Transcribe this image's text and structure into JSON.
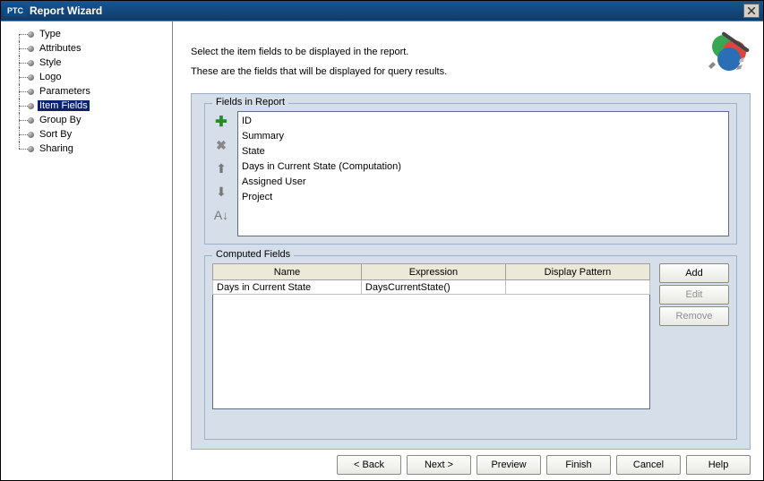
{
  "titlebar": {
    "brand": "PTC",
    "title": "Report Wizard"
  },
  "sidebar": {
    "items": [
      {
        "label": "Type"
      },
      {
        "label": "Attributes"
      },
      {
        "label": "Style"
      },
      {
        "label": "Logo"
      },
      {
        "label": "Parameters"
      },
      {
        "label": "Item Fields",
        "selected": true
      },
      {
        "label": "Group By"
      },
      {
        "label": "Sort By"
      },
      {
        "label": "Sharing"
      }
    ]
  },
  "header": {
    "line1": "Select the item fields to be displayed in the report.",
    "line2": "These are the fields that will be displayed for query results."
  },
  "fieldsInReport": {
    "legend": "Fields in Report",
    "items": [
      "ID",
      "Summary",
      "State",
      "Days in Current State (Computation)",
      "Assigned User",
      "Project"
    ]
  },
  "computedFields": {
    "legend": "Computed Fields",
    "columns": [
      "Name",
      "Expression",
      "Display Pattern"
    ],
    "rows": [
      {
        "name": "Days in Current State",
        "expression": "DaysCurrentState()",
        "displayPattern": ""
      }
    ],
    "buttons": {
      "add": "Add",
      "edit": "Edit",
      "remove": "Remove"
    }
  },
  "buttonBar": {
    "back": "< Back",
    "next": "Next >",
    "preview": "Preview",
    "finish": "Finish",
    "cancel": "Cancel",
    "help": "Help"
  }
}
